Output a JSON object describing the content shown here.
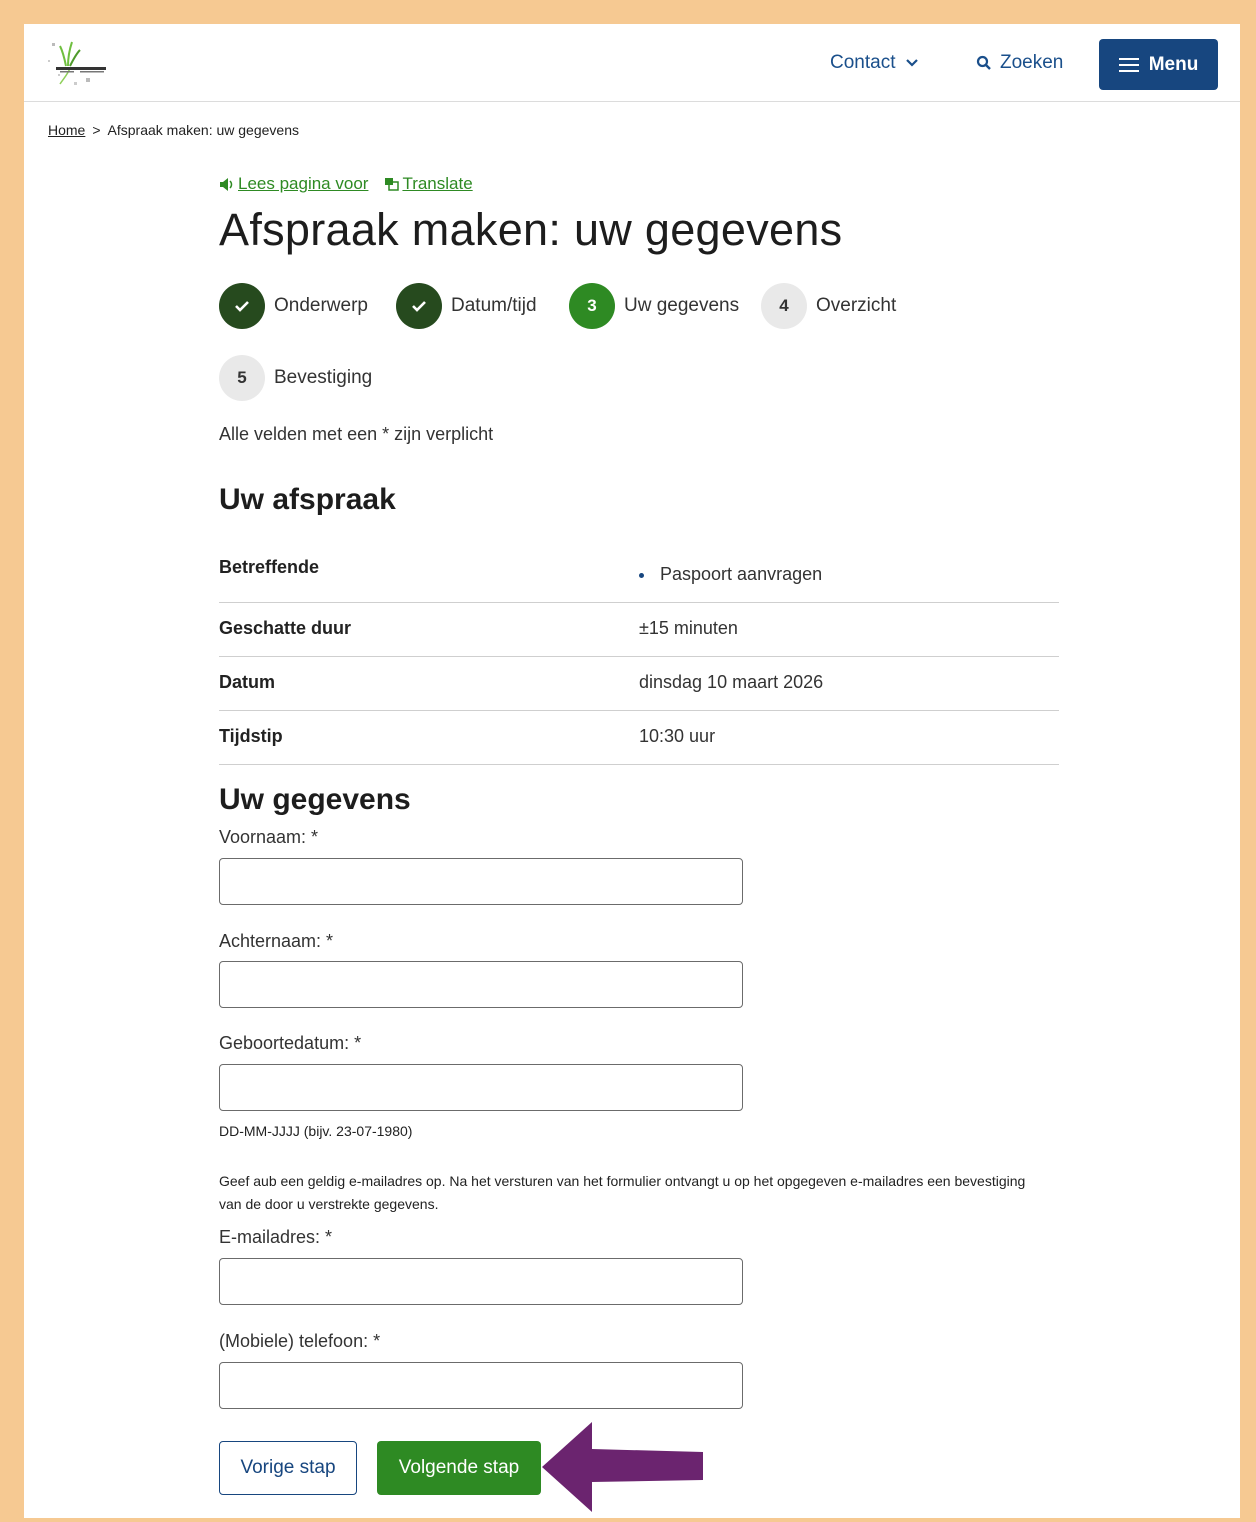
{
  "header": {
    "contact_label": "Contact",
    "search_label": "Zoeken",
    "menu_label": "Menu"
  },
  "breadcrumb": {
    "home": "Home",
    "separator": ">",
    "current": "Afspraak maken: uw gegevens"
  },
  "tools": {
    "read_aloud": "Lees pagina voor",
    "translate": "Translate"
  },
  "page_title": "Afspraak maken: uw gegevens",
  "steps": [
    {
      "number": "1",
      "label": "Onderwerp",
      "state": "done"
    },
    {
      "number": "2",
      "label": "Datum/tijd",
      "state": "done"
    },
    {
      "number": "3",
      "label": "Uw gegevens",
      "state": "active"
    },
    {
      "number": "4",
      "label": "Overzicht",
      "state": "todo"
    },
    {
      "number": "5",
      "label": "Bevestiging",
      "state": "todo"
    }
  ],
  "required_note": "Alle velden met een * zijn verplicht",
  "appointment": {
    "heading": "Uw afspraak",
    "rows": [
      {
        "label": "Betreffende",
        "value": "Paspoort aanvragen"
      },
      {
        "label": "Geschatte duur",
        "value": "±15 minuten"
      },
      {
        "label": "Datum",
        "value": "dinsdag 10 maart 2026"
      },
      {
        "label": "Tijdstip",
        "value": "10:30 uur"
      }
    ]
  },
  "form": {
    "heading": "Uw gegevens",
    "first_name": {
      "label": "Voornaam: *",
      "value": ""
    },
    "last_name": {
      "label": "Achternaam: *",
      "value": ""
    },
    "birth_date": {
      "label": "Geboortedatum: *",
      "value": "",
      "hint": "DD-MM-JJJJ (bijv. 23-07-1980)"
    },
    "email_info": "Geef aub een geldig e-mailadres op. Na het versturen van het formulier ontvangt u op het opgegeven e-mailadres een bevestiging van de door u verstrekte gegevens.",
    "email": {
      "label": "E-mailadres: *",
      "value": ""
    },
    "phone": {
      "label": "(Mobiele) telefoon: *",
      "value": ""
    }
  },
  "buttons": {
    "previous": "Vorige stap",
    "next": "Volgende stap"
  },
  "colors": {
    "brand_blue": "#17467f",
    "brand_green": "#2e8a23",
    "done_green": "#264a1e",
    "frame": "#f6c992",
    "annotation_arrow": "#6b246f"
  }
}
